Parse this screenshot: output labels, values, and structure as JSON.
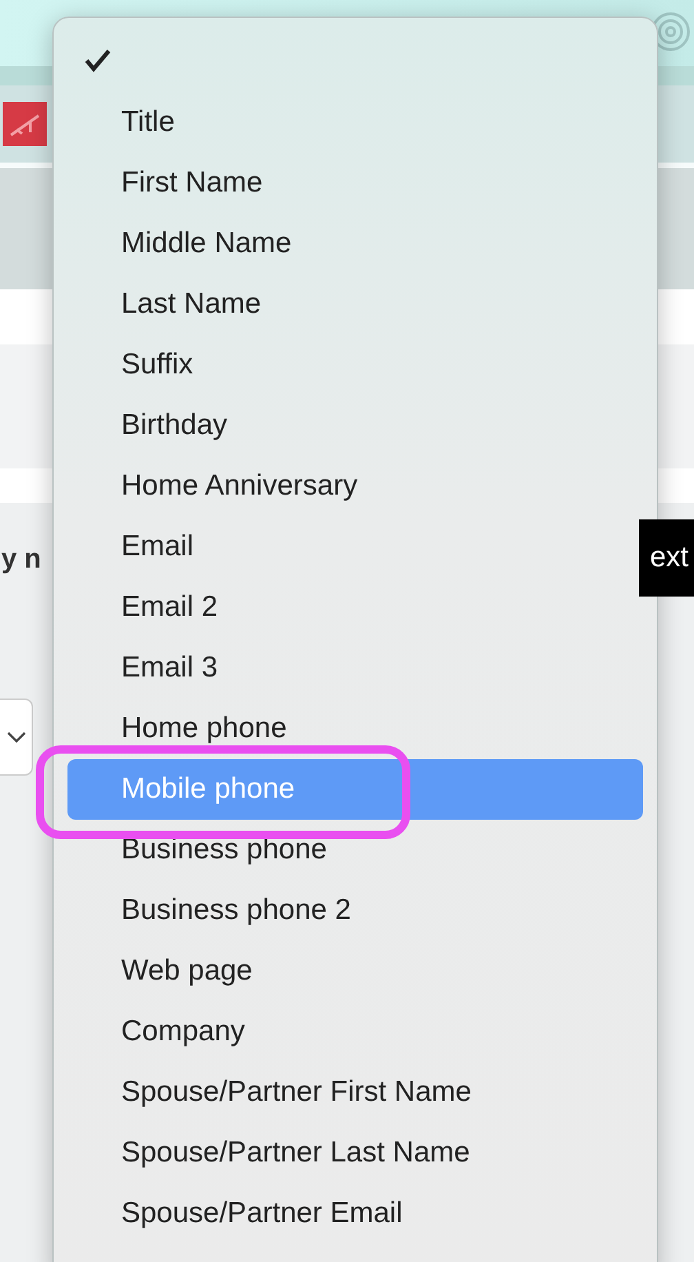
{
  "background": {
    "bold_text": "y n",
    "button": "ext"
  },
  "menu": {
    "items": [
      {
        "checked": true,
        "selected": false
      },
      {
        "label": "Title",
        "checked": false,
        "selected": false
      },
      {
        "label": "First Name",
        "checked": false,
        "selected": false
      },
      {
        "label": "Middle Name",
        "checked": false,
        "selected": false
      },
      {
        "label": "Last Name",
        "checked": false,
        "selected": false
      },
      {
        "label": "Suffix",
        "checked": false,
        "selected": false
      },
      {
        "label": "Birthday",
        "checked": false,
        "selected": false
      },
      {
        "label": "Home Anniversary",
        "checked": false,
        "selected": false
      },
      {
        "label": "Email",
        "checked": false,
        "selected": false
      },
      {
        "label": "Email 2",
        "checked": false,
        "selected": false
      },
      {
        "label": "Email 3",
        "checked": false,
        "selected": false
      },
      {
        "label": "Home phone",
        "checked": false,
        "selected": false
      },
      {
        "label": "Mobile phone",
        "checked": false,
        "selected": true
      },
      {
        "label": "Business phone",
        "checked": false,
        "selected": false
      },
      {
        "label": "Business phone 2",
        "checked": false,
        "selected": false
      },
      {
        "label": "Web page",
        "checked": false,
        "selected": false
      },
      {
        "label": "Company",
        "checked": false,
        "selected": false
      },
      {
        "label": "Spouse/Partner First Name",
        "checked": false,
        "selected": false
      },
      {
        "label": "Spouse/Partner Last Name",
        "checked": false,
        "selected": false
      },
      {
        "label": "Spouse/Partner Email",
        "checked": false,
        "selected": false
      }
    ]
  }
}
